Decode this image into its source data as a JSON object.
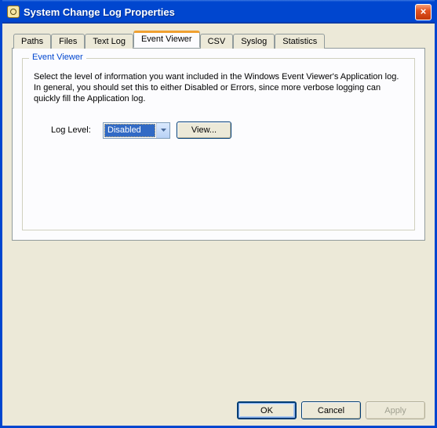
{
  "title": "System Change Log Properties",
  "close_glyph": "×",
  "tabs": [
    {
      "label": "Paths"
    },
    {
      "label": "Files"
    },
    {
      "label": "Text Log"
    },
    {
      "label": "Event Viewer"
    },
    {
      "label": "CSV"
    },
    {
      "label": "Syslog"
    },
    {
      "label": "Statistics"
    }
  ],
  "active_tab": 3,
  "group": {
    "legend": "Event Viewer",
    "desc": "Select the level of information you want included in the Windows Event Viewer's Application log. In general, you should set this to either Disabled or Errors, since more verbose logging can quickly fill the Application log.",
    "loglevel_label": "Log Level:",
    "loglevel_value": "Disabled",
    "view_button": "View..."
  },
  "buttons": {
    "ok": "OK",
    "cancel": "Cancel",
    "apply": "Apply"
  }
}
